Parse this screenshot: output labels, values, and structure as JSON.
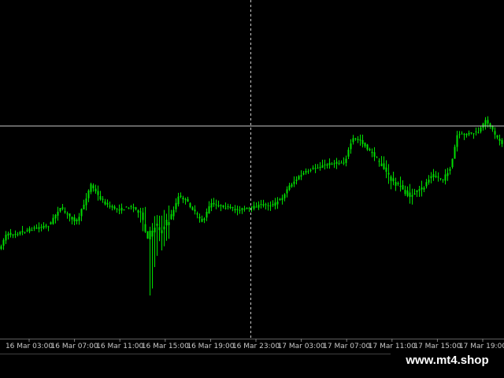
{
  "watermark": "www.mt4.shop",
  "colors": {
    "background": "#000000",
    "candle_bull": "#00e000",
    "candle_bear": "#00e000",
    "axis_text": "#c8c8c8",
    "crosshair": "#c8c8c8"
  },
  "chart_data": {
    "type": "candlestick",
    "x_tick_labels": [
      "16 Mar 03:00",
      "16 Mar 07:00",
      "16 Mar 11:00",
      "16 Mar 15:00",
      "16 Mar 19:00",
      "16 Mar 23:00",
      "17 Mar 03:00",
      "17 Mar 07:00",
      "17 Mar 11:00",
      "17 Mar 15:00",
      "17 Mar 19:00"
    ],
    "grid": false,
    "crosshair": {
      "x_time": "16 Mar 23:00"
    }
  }
}
